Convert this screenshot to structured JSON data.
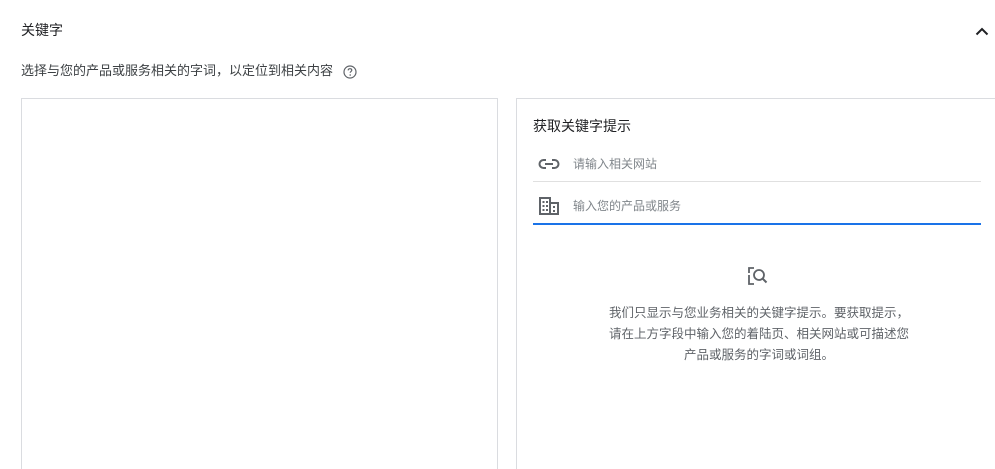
{
  "section": {
    "title": "关键字",
    "subtitle": "选择与您的产品或服务相关的字词，以定位到相关内容"
  },
  "keywords_box": {
    "value": ""
  },
  "suggestions_panel": {
    "title": "获取关键字提示",
    "url_field": {
      "placeholder": "请输入相关网站",
      "value": ""
    },
    "product_field": {
      "placeholder": "输入您的产品或服务",
      "value": ""
    },
    "empty_state_text": "我们只显示与您业务相关的关键字提示。要获取提示，请在上方字段中输入您的着陆页、相关网站或可描述您产品或服务的字词或词组。"
  },
  "icons": {
    "collapse": "chevron-up-icon",
    "help": "help-circle-icon",
    "url": "link-icon",
    "product": "business-building-icon",
    "empty_state": "search-document-icon"
  },
  "colors": {
    "accent": "#1a73e8",
    "border": "#dadce0",
    "icon": "#5f6368"
  }
}
